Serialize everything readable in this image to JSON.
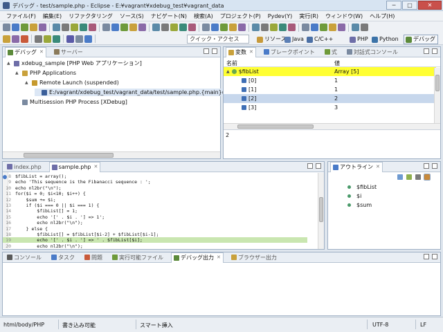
{
  "window": {
    "title": "デバッグ - test/sample.php - Eclipse - E:¥vagrant¥xdebug_test¥vagrant_data",
    "min": "─",
    "max": "□",
    "close": "✕"
  },
  "menu": [
    "ファイル(F)",
    "編集(E)",
    "リファクタリング",
    "ソース(S)",
    "ナビゲート(N)",
    "検索(A)",
    "プロジェクト(P)",
    "Pydev(Y)",
    "実行(R)",
    "ウィンドウ(W)",
    "ヘルプ(H)"
  ],
  "quick_access": "クイック・アクセス",
  "perspectives": [
    {
      "label": "リソース",
      "color": "#c79a3a"
    },
    {
      "label": "Java",
      "color": "#5b7fb5"
    },
    {
      "label": "C/C++",
      "color": "#4a6fa5"
    },
    {
      "label": "PHP",
      "color": "#6e6ea8"
    },
    {
      "label": "Python",
      "color": "#3b73a8"
    },
    {
      "label": "デバッグ",
      "color": "#5c8a3a"
    }
  ],
  "debug_panel": {
    "tabs": [
      {
        "label": "デバッグ"
      },
      {
        "label": "サーバー"
      }
    ],
    "tree": [
      {
        "label": "xdebug_sample [PHP Web アプリケーション]",
        "arrow": "▲",
        "icon": "#6e6ea8"
      },
      {
        "label": "PHP Applications",
        "arrow": "▲",
        "icon": "#c9a13b"
      },
      {
        "label": "Remote Launch (suspended)",
        "arrow": "▲",
        "icon": "#c69a2e"
      },
      {
        "label": "E:/vagrant/xdebug_test/vagrant_data/test/sample.php.{main}():",
        "arrow": "",
        "icon": "#3b5f9a"
      },
      {
        "label": "Multisession PHP Process [XDebug]",
        "arrow": "",
        "icon": "#7a8aa0"
      }
    ]
  },
  "variables_panel": {
    "tabs": [
      {
        "label": "変数"
      },
      {
        "label": "ブレークポイント"
      },
      {
        "label": "式"
      },
      {
        "label": "対話式コンソール"
      }
    ],
    "headers": {
      "name": "名前",
      "value": "値"
    },
    "rows": [
      {
        "name": "$fibList",
        "value": "Array [5]",
        "arrow": "▲"
      },
      {
        "name": "[0]",
        "value": "1",
        "arrow": ""
      },
      {
        "name": "[1]",
        "value": "1",
        "arrow": ""
      },
      {
        "name": "[2]",
        "value": "2",
        "arrow": ""
      },
      {
        "name": "[3]",
        "value": "3",
        "arrow": ""
      }
    ],
    "detail": "2"
  },
  "editor": {
    "tabs": [
      {
        "label": "index.php"
      },
      {
        "label": "sample.php"
      }
    ],
    "lines": [
      {
        "n": "8",
        "text": "$fibList = array();"
      },
      {
        "n": "9",
        "text": "echo 'This sequence is the Fibanacci sequence : ';"
      },
      {
        "n": "10",
        "text": "echo nl2br(\"\\n\");"
      },
      {
        "n": "11",
        "text": "for($i = 0; $i<10; $i++) {"
      },
      {
        "n": "12",
        "text": "    $sum += $i;"
      },
      {
        "n": "13",
        "text": "    if ($i === 0 || $i === 1) {"
      },
      {
        "n": "14",
        "text": "        $fibList[] = 1;"
      },
      {
        "n": "15",
        "text": "        echo '[' . $i . '] => 1';"
      },
      {
        "n": "16",
        "text": "        echo nl2br(\"\\n\");"
      },
      {
        "n": "17",
        "text": "    } else {"
      },
      {
        "n": "18",
        "text": "        $fibList[] = $fibList[$i-2] + $fibList[$i-1];"
      },
      {
        "n": "19",
        "text": "        echo '[' . $i . '] => ' . $fibList[$i];"
      },
      {
        "n": "20",
        "text": "        echo nl2br(\"\\n\");"
      }
    ]
  },
  "outline_panel": {
    "tabs": [
      {
        "label": "アウトライン"
      }
    ],
    "items": [
      "$fibList",
      "$i",
      "$sum"
    ]
  },
  "bottom_panel": {
    "tabs": [
      {
        "label": "コンソール"
      },
      {
        "label": "タスク"
      },
      {
        "label": "問題"
      },
      {
        "label": "実行可能ファイル"
      },
      {
        "label": "デバッグ出力"
      },
      {
        "label": "ブラウザー出力"
      }
    ]
  },
  "status": {
    "path": "html/body/PHP",
    "mode": "書き込み可能",
    "insert": "スマート挿入",
    "encoding": "UTF-8",
    "eol": "LF"
  }
}
